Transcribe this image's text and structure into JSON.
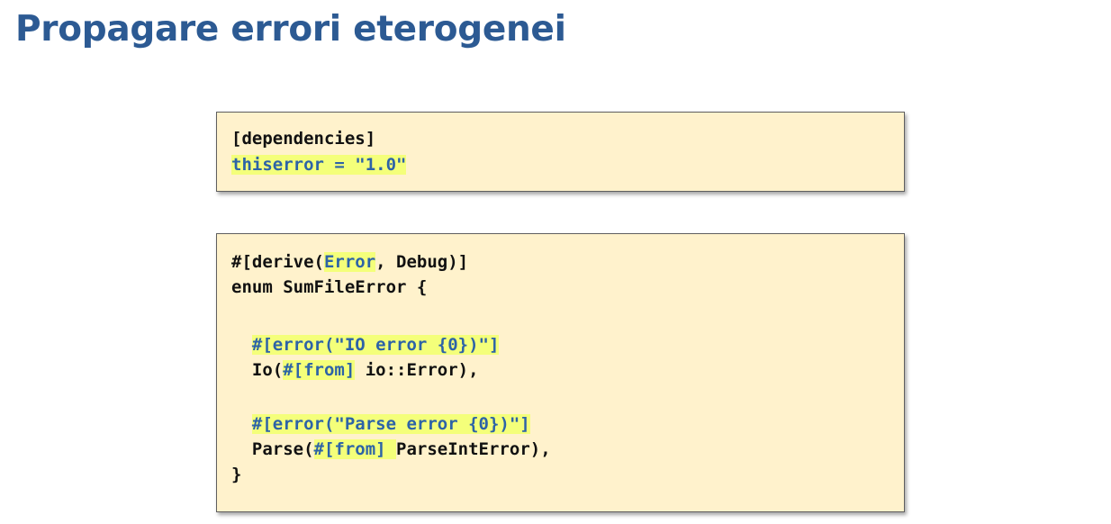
{
  "slide": {
    "title": "Propagare errori eterogenei"
  },
  "cargo_box": {
    "line1": "[dependencies]",
    "line2": "thiserror = \"1.0\""
  },
  "enum_box": {
    "derive_prefix": "#[derive(",
    "derive_error": "Error",
    "derive_suffix": ", Debug)]",
    "enum_decl": "enum SumFileError {",
    "io_attr": "#[error(\"IO error {0})\"]",
    "io_open": "Io(",
    "io_from": "#[from]",
    "io_rest": " io::Error),",
    "parse_attr": "#[error(\"Parse error {0})\"]",
    "parse_open": "Parse(",
    "parse_from": "#[from] ",
    "parse_rest": "ParseIntError),",
    "close": "}",
    "indent": "  "
  },
  "colors": {
    "title": "#2c5a93",
    "box_background": "#fff2cc",
    "highlight": "#f4ff7a",
    "highlight_text": "#2d63a7"
  }
}
